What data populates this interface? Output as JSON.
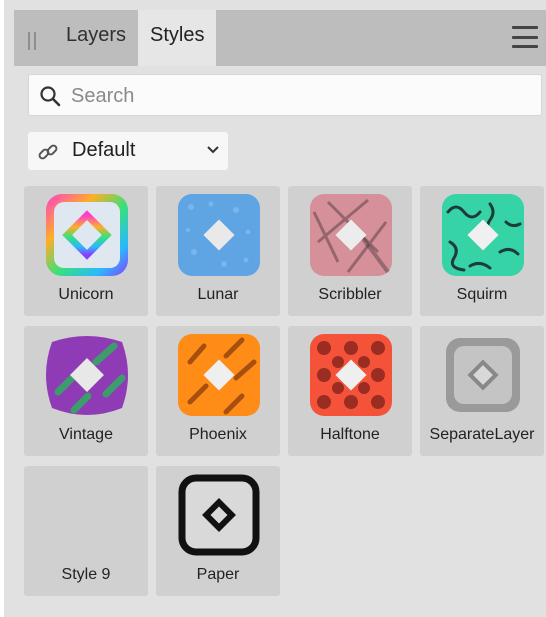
{
  "tabs": [
    {
      "label": "Layers",
      "active": false
    },
    {
      "label": "Styles",
      "active": true
    }
  ],
  "search": {
    "placeholder": "Search",
    "value": ""
  },
  "category": {
    "selected": "Default"
  },
  "styles": [
    {
      "name": "Unicorn"
    },
    {
      "name": "Lunar"
    },
    {
      "name": "Scribbler"
    },
    {
      "name": "Squirm"
    },
    {
      "name": "Vintage"
    },
    {
      "name": "Phoenix"
    },
    {
      "name": "Halftone"
    },
    {
      "name": "SeparateLayer"
    },
    {
      "name": "Style 9"
    },
    {
      "name": "Paper"
    }
  ],
  "colors": {
    "panel_bg": "#e1e1e1",
    "tab_bar_bg": "#bdbdbd",
    "active_tab_bg": "#e6e6e6",
    "tile_bg": "#d0d0d0"
  }
}
